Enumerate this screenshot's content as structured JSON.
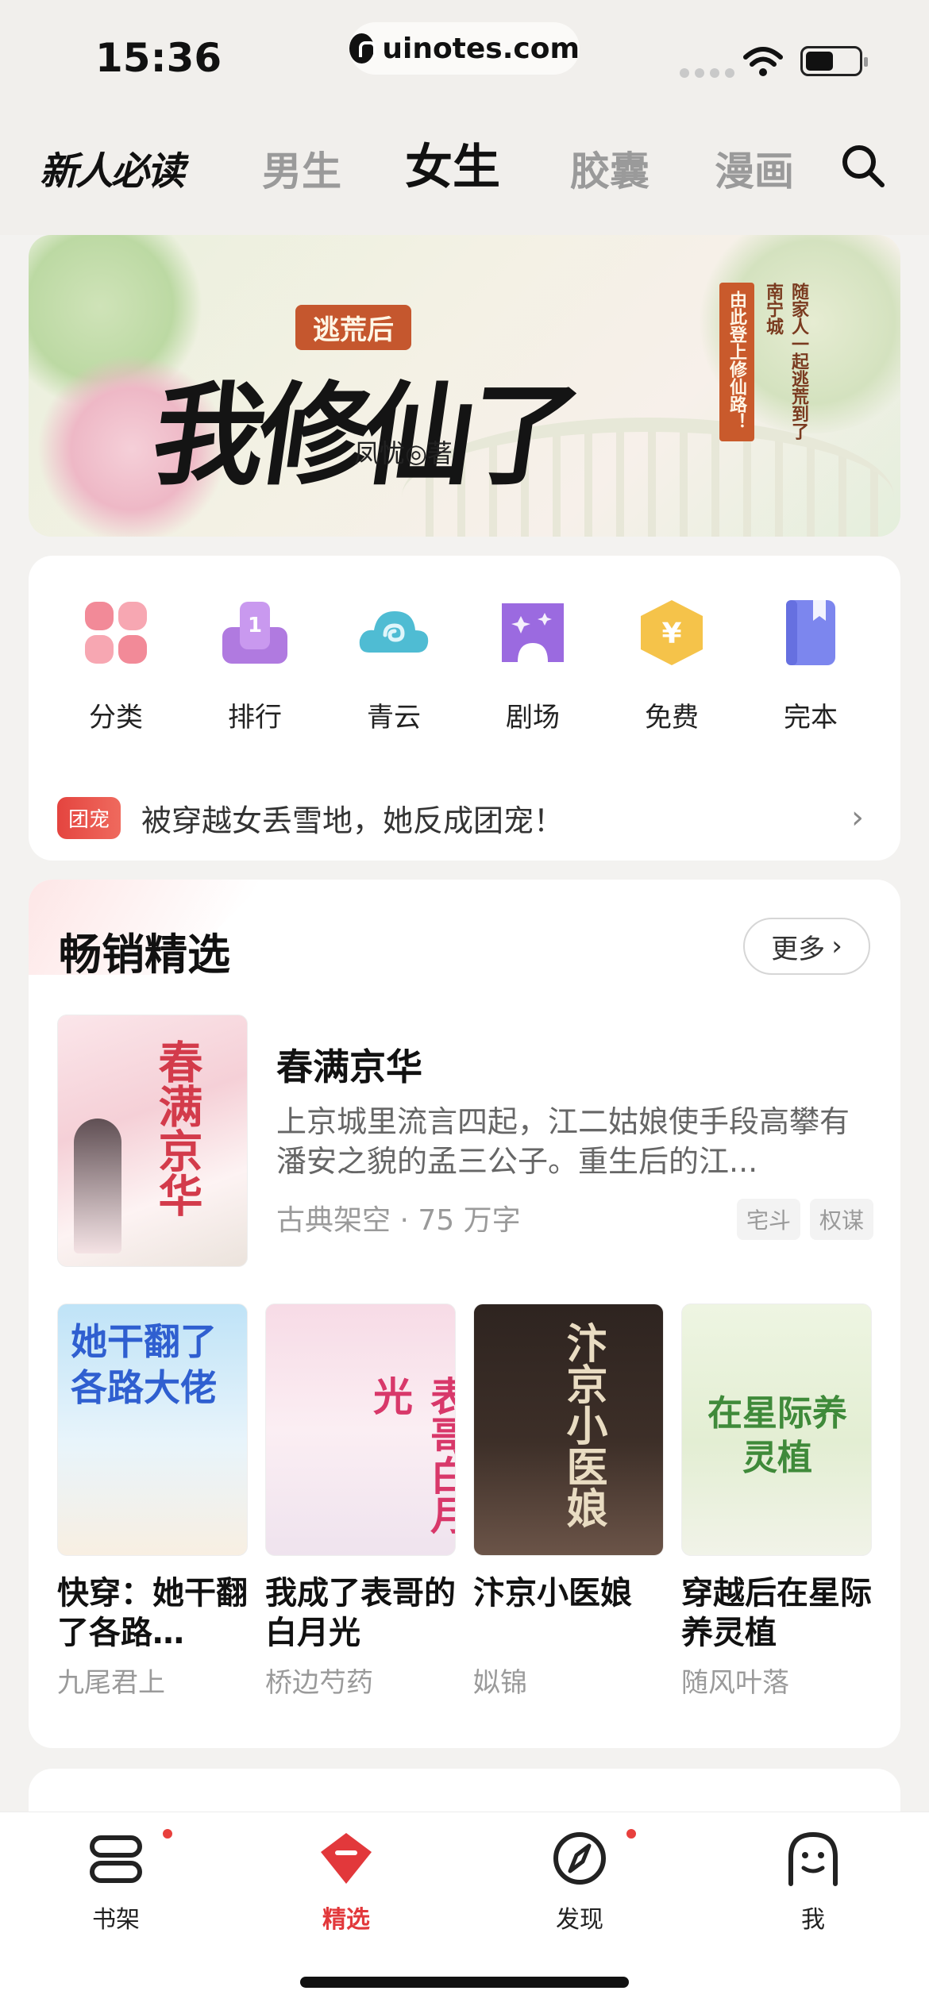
{
  "status": {
    "time": "15:36",
    "url": "uinotes.com"
  },
  "nav": {
    "logo": "新人必读",
    "tabs": [
      {
        "label": "男生"
      },
      {
        "label": "女生"
      },
      {
        "label": "胶囊"
      },
      {
        "label": "漫画"
      }
    ],
    "active_tab": "女生"
  },
  "banner": {
    "subtitle": "逃荒后",
    "title": "我修仙了",
    "author": "凤忧◎著",
    "vertical_red": "由此登上修仙路！",
    "vertical_dark": "随家人一起逃荒到了南宁城"
  },
  "categories": [
    {
      "label": "分类",
      "icon": "category-grid-icon",
      "color": "#f28a98"
    },
    {
      "label": "排行",
      "icon": "ranking-podium-icon",
      "color": "#b07ae0"
    },
    {
      "label": "青云",
      "icon": "cloud-icon",
      "color": "#4fbcd3"
    },
    {
      "label": "剧场",
      "icon": "theater-icon",
      "color": "#9b6ae0"
    },
    {
      "label": "免费",
      "icon": "yuan-coin-icon",
      "color": "#f5c34a"
    },
    {
      "label": "完本",
      "icon": "bookmark-book-icon",
      "color": "#7c86ee"
    }
  ],
  "notice": {
    "tag": "团宠",
    "text": "被穿越女丢雪地，她反成团宠！"
  },
  "bestseller": {
    "heading": "畅销精选",
    "more_label": "更多",
    "featured": {
      "title": "春满京华",
      "cover_text": "春满京华",
      "description": "上京城里流言四起，江二姑娘使手段高攀有潘安之貌的孟三公子。重生后的江...",
      "meta": "古典架空 · 75 万字",
      "tags": [
        "宅斗",
        "权谋"
      ]
    },
    "books": [
      {
        "title": "快穿：她干翻了各路…",
        "author": "九尾君上",
        "cover_text": "她干翻了各路大佬"
      },
      {
        "title": "我成了表哥的白月光",
        "author": "桥边芍药",
        "cover_text": "表哥白月光"
      },
      {
        "title": "汴京小医娘",
        "author": "姒锦",
        "cover_text": "汴京小医娘"
      },
      {
        "title": "穿越后在星际养灵植",
        "author": "随风叶落",
        "cover_text": "在星际养灵植"
      }
    ]
  },
  "tabbar": [
    {
      "label": "书架",
      "icon": "bookshelf-icon",
      "badge": true
    },
    {
      "label": "精选",
      "icon": "featured-gem-icon",
      "badge": false,
      "active": true
    },
    {
      "label": "发现",
      "icon": "compass-icon",
      "badge": true
    },
    {
      "label": "我",
      "icon": "profile-face-icon",
      "badge": false
    }
  ],
  "colors": {
    "accent": "#e2383b",
    "background": "#f3f2f0"
  }
}
